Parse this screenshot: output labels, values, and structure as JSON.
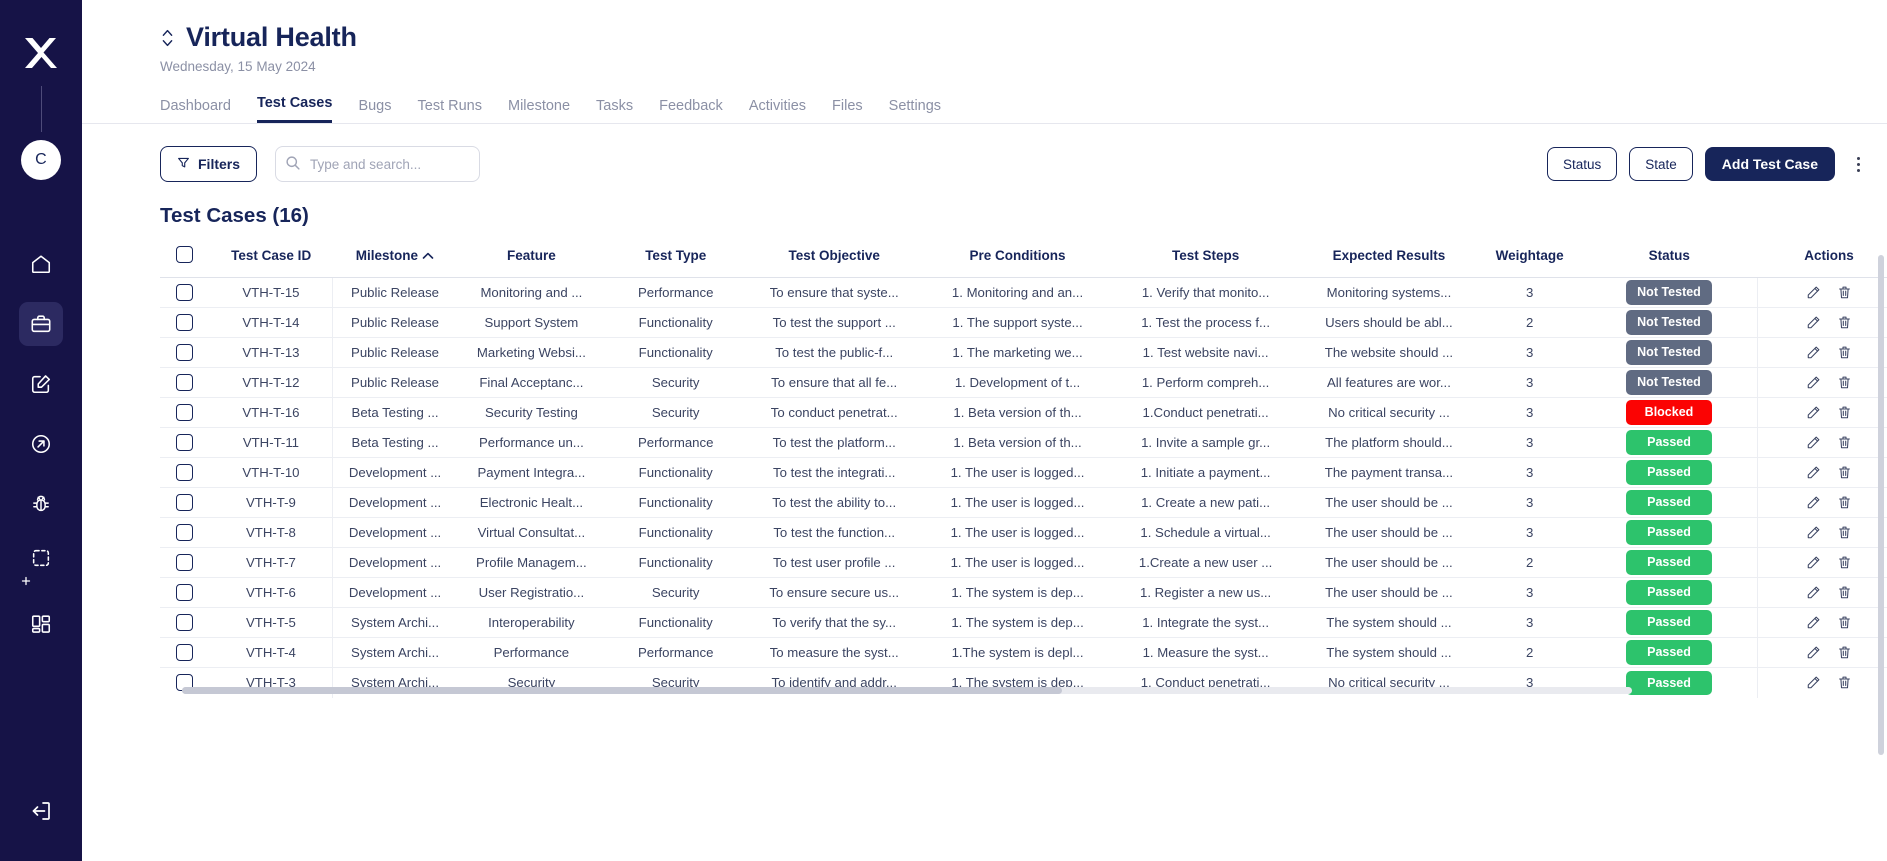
{
  "sidebar": {
    "logo_icon": "x-logo-icon",
    "avatar_initial": "C",
    "items": [
      {
        "icon": "home-icon",
        "name": "home",
        "active": false
      },
      {
        "icon": "briefcase-icon",
        "name": "projects",
        "active": true
      },
      {
        "icon": "edit-square-icon",
        "name": "test-cases",
        "active": false
      },
      {
        "icon": "arrow-circle-icon",
        "name": "test-runs",
        "active": false
      },
      {
        "icon": "bug-icon",
        "name": "bugs",
        "active": false
      },
      {
        "icon": "add-selection-icon",
        "name": "capture",
        "active": false
      },
      {
        "icon": "grid-icon",
        "name": "apps",
        "active": false
      }
    ],
    "bottom_icon": "logout-icon"
  },
  "header": {
    "sort_icon": "chevron-updown-icon",
    "title": "Virtual Health",
    "date": "Wednesday, 15 May 2024"
  },
  "tabs": [
    {
      "label": "Dashboard",
      "active": false
    },
    {
      "label": "Test Cases",
      "active": true
    },
    {
      "label": "Bugs",
      "active": false
    },
    {
      "label": "Test Runs",
      "active": false
    },
    {
      "label": "Milestone",
      "active": false
    },
    {
      "label": "Tasks",
      "active": false
    },
    {
      "label": "Feedback",
      "active": false
    },
    {
      "label": "Activities",
      "active": false
    },
    {
      "label": "Files",
      "active": false
    },
    {
      "label": "Settings",
      "active": false
    }
  ],
  "toolbar": {
    "filters_label": "Filters",
    "filter_icon": "funnel-icon",
    "search_placeholder": "Type and search...",
    "search_value": "",
    "search_icon": "search-icon",
    "status_label": "Status",
    "state_label": "State",
    "add_label": "Add Test Case",
    "more_icon": "kebab-menu-icon"
  },
  "section": {
    "title": "Test Cases (16)",
    "count": 16
  },
  "table": {
    "columns": [
      "Test Case ID",
      "Milestone",
      "Feature",
      "Test Type",
      "Test Objective",
      "Pre Conditions",
      "Test Steps",
      "Expected Results",
      "Weightage",
      "Status",
      "Actions"
    ],
    "sorted_column": "Milestone",
    "sort_direction_icon": "chevron-up-icon",
    "select_all_checked": false,
    "edit_icon": "pencil-icon",
    "delete_icon": "trash-icon",
    "rows": [
      {
        "id": "VTH-T-15",
        "milestone": "Public Release",
        "feature": "Monitoring and ...",
        "type": "Performance",
        "objective": "To ensure that syste...",
        "pre": "1. Monitoring and an...",
        "steps": "1. Verify that monito...",
        "expected": "Monitoring systems...",
        "weightage": "3",
        "status": "Not Tested",
        "status_class": "nottested"
      },
      {
        "id": "VTH-T-14",
        "milestone": "Public Release",
        "feature": "Support System",
        "type": "Functionality",
        "objective": "To test the support ...",
        "pre": "1. The support syste...",
        "steps": "1. Test the process f...",
        "expected": "Users should be abl...",
        "weightage": "2",
        "status": "Not Tested",
        "status_class": "nottested"
      },
      {
        "id": "VTH-T-13",
        "milestone": "Public Release",
        "feature": "Marketing Websi...",
        "type": "Functionality",
        "objective": "To test the public-f...",
        "pre": "1. The marketing we...",
        "steps": "1. Test website navi...",
        "expected": "The website should ...",
        "weightage": "3",
        "status": "Not Tested",
        "status_class": "nottested"
      },
      {
        "id": "VTH-T-12",
        "milestone": "Public Release",
        "feature": "Final Acceptanc...",
        "type": "Security",
        "objective": "To ensure that all fe...",
        "pre": "1. Development of t...",
        "steps": "1. Perform compreh...",
        "expected": "All features are wor...",
        "weightage": "3",
        "status": "Not Tested",
        "status_class": "nottested"
      },
      {
        "id": "VTH-T-16",
        "milestone": "Beta Testing ...",
        "feature": "Security Testing",
        "type": "Security",
        "objective": "To conduct penetrat...",
        "pre": "1. Beta version of th...",
        "steps": "1.Conduct penetrati...",
        "expected": "No critical security ...",
        "weightage": "3",
        "status": "Blocked",
        "status_class": "blocked"
      },
      {
        "id": "VTH-T-11",
        "milestone": "Beta Testing ...",
        "feature": "Performance un...",
        "type": "Performance",
        "objective": "To test the platform...",
        "pre": "1. Beta version of th...",
        "steps": "1. Invite a sample gr...",
        "expected": "The platform should...",
        "weightage": "3",
        "status": "Passed",
        "status_class": "passed"
      },
      {
        "id": "VTH-T-10",
        "milestone": "Development ...",
        "feature": "Payment Integra...",
        "type": "Functionality",
        "objective": "To test the integrati...",
        "pre": "1. The user is logged...",
        "steps": "1. Initiate a payment...",
        "expected": "The payment transa...",
        "weightage": "3",
        "status": "Passed",
        "status_class": "passed"
      },
      {
        "id": "VTH-T-9",
        "milestone": "Development ...",
        "feature": "Electronic Healt...",
        "type": "Functionality",
        "objective": "To test the ability to...",
        "pre": "1. The user is logged...",
        "steps": "1. Create a new pati...",
        "expected": "The user should be ...",
        "weightage": "3",
        "status": "Passed",
        "status_class": "passed"
      },
      {
        "id": "VTH-T-8",
        "milestone": "Development ...",
        "feature": "Virtual Consultat...",
        "type": "Functionality",
        "objective": "To test the function...",
        "pre": "1. The user is logged...",
        "steps": "1. Schedule a virtual...",
        "expected": "The user should be ...",
        "weightage": "3",
        "status": "Passed",
        "status_class": "passed"
      },
      {
        "id": "VTH-T-7",
        "milestone": "Development ...",
        "feature": "Profile Managem...",
        "type": "Functionality",
        "objective": "To test user profile ...",
        "pre": "1. The user is logged...",
        "steps": "1.Create a new user ...",
        "expected": "The user should be ...",
        "weightage": "2",
        "status": "Passed",
        "status_class": "passed"
      },
      {
        "id": "VTH-T-6",
        "milestone": "Development ...",
        "feature": "User Registratio...",
        "type": "Security",
        "objective": "To ensure secure us...",
        "pre": "1. The system is dep...",
        "steps": "1. Register a new us...",
        "expected": "The user should be ...",
        "weightage": "3",
        "status": "Passed",
        "status_class": "passed"
      },
      {
        "id": "VTH-T-5",
        "milestone": "System Archi...",
        "feature": "Interoperability",
        "type": "Functionality",
        "objective": "To verify that the sy...",
        "pre": "1. The system is dep...",
        "steps": "1. Integrate the syst...",
        "expected": "The system should ...",
        "weightage": "3",
        "status": "Passed",
        "status_class": "passed"
      },
      {
        "id": "VTH-T-4",
        "milestone": "System Archi...",
        "feature": "Performance",
        "type": "Performance",
        "objective": "To measure the syst...",
        "pre": "1.The system is depl...",
        "steps": "1. Measure the syst...",
        "expected": "The system should ...",
        "weightage": "2",
        "status": "Passed",
        "status_class": "passed"
      },
      {
        "id": "VTH-T-3",
        "milestone": "System Archi...",
        "feature": "Security",
        "type": "Security",
        "objective": "To identify and addr...",
        "pre": "1. The system is dep...",
        "steps": "1. Conduct penetrati...",
        "expected": "No critical security ...",
        "weightage": "3",
        "status": "Passed",
        "status_class": "passed"
      }
    ]
  },
  "colors": {
    "sidebar_bg": "#161347",
    "brand": "#17255a",
    "passed": "#2dc36c",
    "blocked": "#fb0303",
    "not_tested": "#606b82"
  }
}
